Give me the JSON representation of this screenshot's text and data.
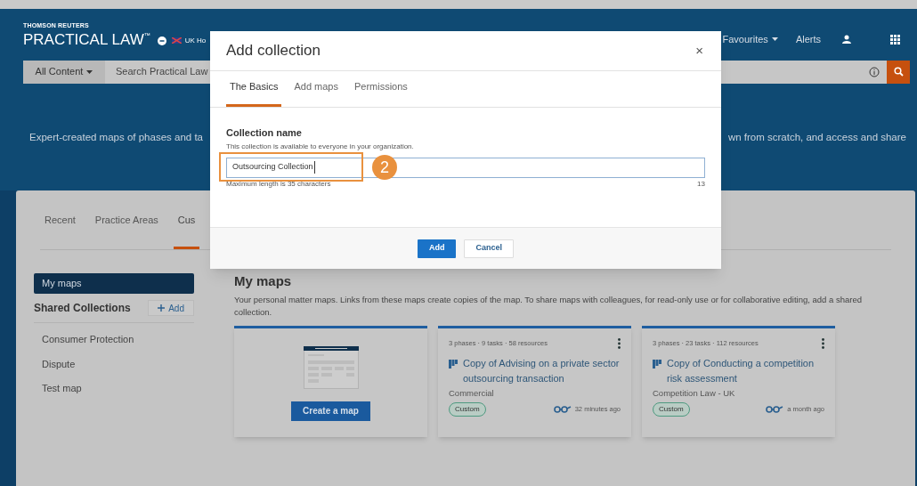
{
  "header": {
    "brand_top": "THOMSON REUTERS",
    "brand": "PRACTICAL LAW",
    "trademark": "™",
    "region": "UK Ho",
    "nav": [
      "Favourites",
      "Alerts"
    ],
    "search": {
      "scope": "All Content",
      "placeholder": "Search Practical Law"
    },
    "tagline_left": "Expert-created maps of phases and ta",
    "tagline_right": "wn from scratch, and access and share"
  },
  "tabs": [
    {
      "label": "Recent",
      "selected": false
    },
    {
      "label": "Practice Areas",
      "selected": false
    },
    {
      "label": "Cus",
      "selected": true
    }
  ],
  "sidebar": {
    "items": [
      {
        "label": "My maps",
        "selected": true
      }
    ],
    "shared_title": "Shared Collections",
    "add_label": "Add",
    "collections": [
      "Consumer Protection",
      "Dispute",
      "Test map"
    ]
  },
  "main": {
    "title": "My maps",
    "description": "Your personal matter maps. Links from these maps create copies of the map. To share maps with colleagues, for read-only use or for collaborative editing, add a shared collection.",
    "create_button": "Create a map",
    "maps": [
      {
        "meta": "3 phases · 9 tasks · 58 resources",
        "title": "Copy of Advising on a private sector outsourcing transaction",
        "area": "Commercial",
        "tag": "Custom",
        "time": "32 minutes ago"
      },
      {
        "meta": "3 phases · 23 tasks · 112 resources",
        "title": "Copy of Conducting a competition risk assessment",
        "area": "Competition Law - UK",
        "tag": "Custom",
        "time": "a month ago"
      }
    ]
  },
  "modal": {
    "title": "Add collection",
    "close": "×",
    "tabs": [
      {
        "label": "The Basics",
        "selected": true
      },
      {
        "label": "Add maps",
        "selected": false
      },
      {
        "label": "Permissions",
        "selected": false
      }
    ],
    "field": {
      "label": "Collection name",
      "help": "This collection is available to everyone in your organization.",
      "value": "Outsourcing Collection",
      "hint": "Maximum length is 35 characters",
      "count": "13"
    },
    "buttons": [
      {
        "label": "Add",
        "kind": "primary"
      },
      {
        "label": "Cancel",
        "kind": "secondary"
      }
    ],
    "callout": "2"
  }
}
